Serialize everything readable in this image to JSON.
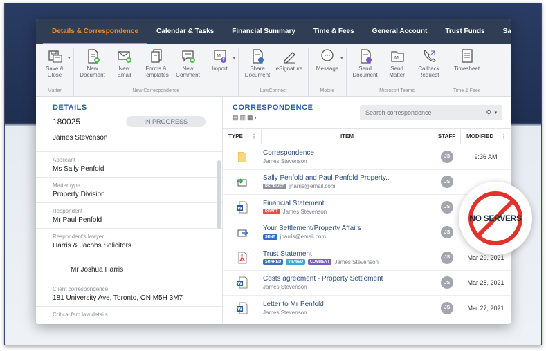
{
  "nav": {
    "tabs": [
      {
        "label": "Details & Correspondence",
        "active": true
      },
      {
        "label": "Calendar & Tasks"
      },
      {
        "label": "Financial Summary"
      },
      {
        "label": "Time & Fees"
      },
      {
        "label": "General Account"
      },
      {
        "label": "Trust Funds"
      },
      {
        "label": "Safe Custody"
      }
    ]
  },
  "ribbon": {
    "groups": [
      {
        "title": "Matter",
        "buttons": [
          {
            "label": "Save &\nClose",
            "icon": "save-icon"
          }
        ]
      },
      {
        "title": "New Correspondence",
        "buttons": [
          {
            "label": "New\nDocument",
            "icon": "new-document-icon"
          },
          {
            "label": "New\nEmail",
            "icon": "new-email-icon"
          },
          {
            "label": "Forms &\nTemplates",
            "icon": "forms-icon"
          },
          {
            "label": "New\nComment",
            "icon": "new-comment-icon"
          },
          {
            "label": "Import",
            "icon": "import-icon"
          }
        ]
      },
      {
        "title": "LawConnect",
        "buttons": [
          {
            "label": "Share\nDocument",
            "icon": "share-document-icon"
          },
          {
            "label": "eSignature",
            "icon": "esignature-icon"
          }
        ]
      },
      {
        "title": "Mobile",
        "buttons": [
          {
            "label": "Message",
            "icon": "message-icon"
          }
        ]
      },
      {
        "title": "Microsoft Teams",
        "buttons": [
          {
            "label": "Send\nDocument",
            "icon": "send-document-icon"
          },
          {
            "label": "Send\nMatter",
            "icon": "send-matter-icon"
          },
          {
            "label": "Callback\nRequest",
            "icon": "callback-icon"
          }
        ]
      },
      {
        "title": "Time & Fees",
        "buttons": [
          {
            "label": "Timesheet",
            "icon": "timesheet-icon"
          }
        ]
      }
    ]
  },
  "details": {
    "title": "DETAILS",
    "matter_number": "180025",
    "status": "IN PROGRESS",
    "client": "James Stevenson",
    "fields": [
      {
        "label": "Applicant",
        "value": "Ms Sally Penfold"
      },
      {
        "label": "Matter type",
        "value": "Property Division"
      },
      {
        "label": "Respondent",
        "value": "Mr Paul Penfold"
      },
      {
        "label": "Respondent's lawyer",
        "value": "Harris & Jacobs Solicitors"
      },
      {
        "label": "",
        "value": "Mr Joshua Harris"
      },
      {
        "label": "Client correspondence",
        "value": "181 University Ave, Toronto, ON M5H 3M7"
      },
      {
        "label": "Critical fam law details",
        "value": ""
      }
    ]
  },
  "correspondence": {
    "title": "CORRESPONDENCE",
    "search_placeholder": "Search correspondence",
    "columns": {
      "type": "TYPE",
      "item": "ITEM",
      "staff": "STAFF",
      "modified": "MODIFIED"
    },
    "rows": [
      {
        "icon": "folder-icon",
        "title": "Correspondence",
        "tags": [],
        "sub": "James Stevenson",
        "staff": "JS",
        "modified": "9:36 AM"
      },
      {
        "icon": "received-email-icon",
        "title": "Sally Penfold and Paul Penfold Property..",
        "tags": [
          {
            "text": "RECEIVED",
            "color": "#8d939c"
          }
        ],
        "sub": "jharris@email.com",
        "staff": "JS",
        "modified": ""
      },
      {
        "icon": "word-doc-icon",
        "title": "Financial Statement",
        "tags": [
          {
            "text": "DRAFT",
            "color": "#d9534f"
          }
        ],
        "sub": "James Stevenson",
        "staff": "JS",
        "modified": ""
      },
      {
        "icon": "sent-email-icon",
        "title": "Your Settlement/Property Affairs",
        "tags": [
          {
            "text": "SENT",
            "color": "#2e6fc4"
          }
        ],
        "sub": "jharris@email.com",
        "staff": "JS",
        "modified": ""
      },
      {
        "icon": "pdf-icon",
        "title": "Trust Statement",
        "tags": [
          {
            "text": "SHARED",
            "color": "#3b72c0"
          },
          {
            "text": "VIEWED",
            "color": "#3aa8d8"
          },
          {
            "text": "COMMENT",
            "color": "#7b5cc4"
          }
        ],
        "sub": "James Stevenson",
        "staff": "JS",
        "modified": "Mar 29, 2021"
      },
      {
        "icon": "word-doc-icon",
        "title": "Costs agreement - Property Settlement",
        "tags": [],
        "sub": "James Stevenson",
        "staff": "JS",
        "modified": "Mar 28, 2021"
      },
      {
        "icon": "word-doc-icon",
        "title": "Letter to Mr Penfold",
        "tags": [],
        "sub": "James Stevenson",
        "staff": "JS",
        "modified": "Mar 27, 2021"
      }
    ]
  },
  "badge": {
    "text": "NO SERVERS"
  }
}
